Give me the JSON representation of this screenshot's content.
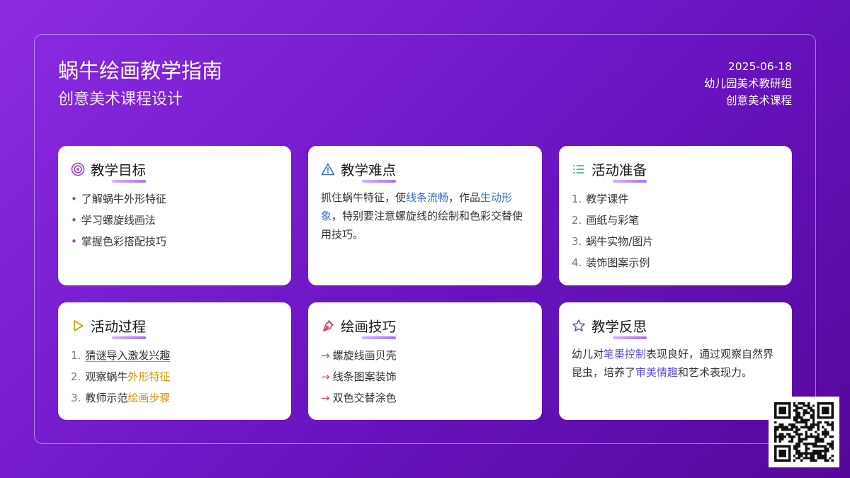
{
  "header": {
    "title": "蜗牛绘画教学指南",
    "subtitle": "创意美术课程设计",
    "date": "2025-06-18",
    "org": "幼儿园美术教研组",
    "course": "创意美术课程"
  },
  "cards": {
    "goals": {
      "title": "教学目标",
      "icon": "target-icon",
      "items": [
        "了解蜗牛外形特征",
        "学习螺旋线画法",
        "掌握色彩搭配技巧"
      ]
    },
    "difficulty": {
      "title": "教学难点",
      "icon": "warning-icon",
      "p1": "抓住蜗牛特征，使",
      "h1": "线条流畅",
      "p2": "，作品",
      "h2": "生动形象",
      "p3": "，特别要注意螺旋线的绘制和色彩交替使用技巧。"
    },
    "prep": {
      "title": "活动准备",
      "icon": "list-icon",
      "items": [
        "教学课件",
        "画纸与彩笔",
        "蜗牛实物/图片",
        "装饰图案示例"
      ]
    },
    "process": {
      "title": "活动过程",
      "icon": "play-icon",
      "item1": "猜谜导入激发兴趣",
      "item2_pre": "观察蜗牛",
      "item2_hl": "外形特征",
      "item3_pre": "教师示范",
      "item3_hl": "绘画步骤"
    },
    "tips": {
      "title": "绘画技巧",
      "icon": "pen-icon",
      "items": [
        "螺旋线画贝壳",
        "线条图案装饰",
        "双色交替涂色"
      ]
    },
    "reflection": {
      "title": "教学反思",
      "icon": "star-icon",
      "p1": "幼儿对",
      "h1": "笔墨控制",
      "p2": "表现良好，通过观察自然界昆虫，培养了",
      "h2": "审美情趣",
      "p3": "和艺术表现力。"
    }
  },
  "colors": {
    "background_start": "#8b2be2",
    "background_end": "#55089a",
    "accent_purple": "#9b3ad6",
    "highlight_blue": "#3a6fd1",
    "highlight_gold": "#d49300",
    "arrow_red": "#e0356a"
  }
}
